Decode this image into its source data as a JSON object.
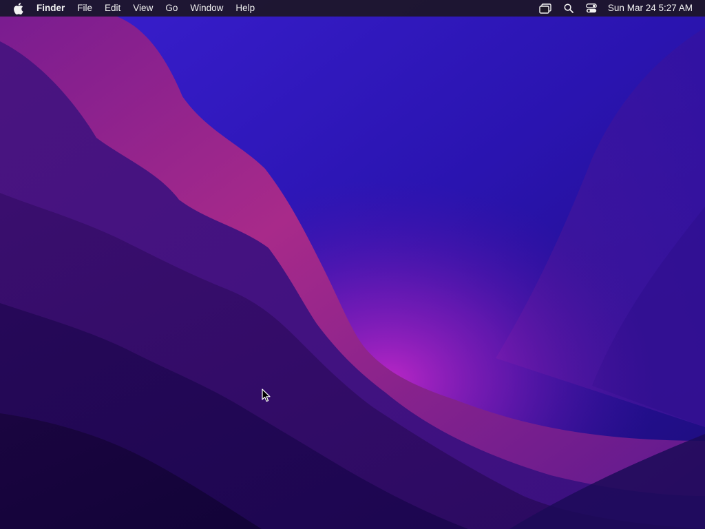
{
  "menubar": {
    "apple_icon": "apple-logo-icon",
    "app_name": "Finder",
    "menus": [
      "File",
      "Edit",
      "View",
      "Go",
      "Window",
      "Help"
    ],
    "status_icons": [
      "screen-mirroring-icon",
      "spotlight-search-icon",
      "control-center-icon"
    ],
    "clock": "Sun Mar 24  5:27 AM"
  },
  "colors": {
    "menubar_bg": "#1c1626",
    "wallpaper_sky": "#2a17b8",
    "wallpaper_glow": "#a020c0",
    "wallpaper_dark": "#150540"
  },
  "cursor": {
    "icon": "arrow-pointer-icon"
  }
}
